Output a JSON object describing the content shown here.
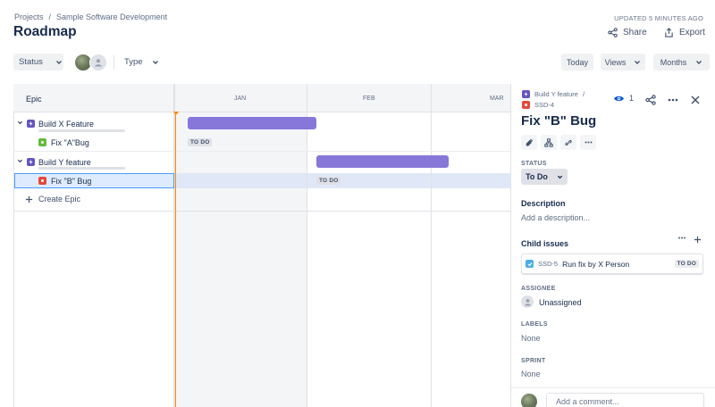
{
  "breadcrumb": {
    "projects": "Projects",
    "separator": "/",
    "project": "Sample Software Development"
  },
  "page": {
    "title": "Roadmap",
    "updated": "UPDATED 5 MINUTES AGO"
  },
  "header_actions": {
    "share": "Share",
    "export": "Export"
  },
  "toolbar": {
    "status_filter": "Status",
    "type_filter": "Type",
    "today": "Today",
    "views": "Views",
    "months": "Months"
  },
  "roadmap": {
    "epic_column": "Epic",
    "months": [
      "JAN",
      "FEB",
      "MAR"
    ],
    "rows": [
      {
        "type": "epic",
        "label": "Build X Feature"
      },
      {
        "type": "story",
        "label": "Fix \"A\"Bug",
        "status": "TO DO"
      },
      {
        "type": "epic",
        "label": "Build Y feature"
      },
      {
        "type": "bug",
        "label": "Fix \"B\" Bug",
        "status": "TO DO"
      }
    ],
    "create_epic": "Create Epic"
  },
  "panel": {
    "parent": "Build Y feature",
    "separator": "/",
    "issue_key": "SSD-4",
    "watchers": "1",
    "title": "Fix \"B\" Bug",
    "status_label": "STATUS",
    "status_value": "To Do",
    "description_label": "Description",
    "description_placeholder": "Add a description...",
    "child_issues_label": "Child issues",
    "child_issue": {
      "key": "SSD-5",
      "summary": "Run fix by X Person",
      "status": "TO DO"
    },
    "assignee_label": "ASSIGNEE",
    "assignee_value": "Unassigned",
    "labels_label": "LABELS",
    "labels_value": "None",
    "sprint_label": "SPRINT",
    "sprint_value": "None",
    "comment_placeholder": "Add a comment..."
  },
  "colors": {
    "epic": "#6554c0",
    "epic_bar": "#8777d9",
    "story": "#63ba3c",
    "bug": "#e5493a",
    "task": "#4bade8",
    "today_line": "#ff8b00",
    "selection": "#4c9aff"
  },
  "icons": [
    "share-icon",
    "export-icon",
    "chevron-down-icon",
    "eye-icon",
    "more-icon",
    "close-icon",
    "attachment-icon",
    "hierarchy-icon",
    "link-icon",
    "plus-icon",
    "user-icon"
  ]
}
